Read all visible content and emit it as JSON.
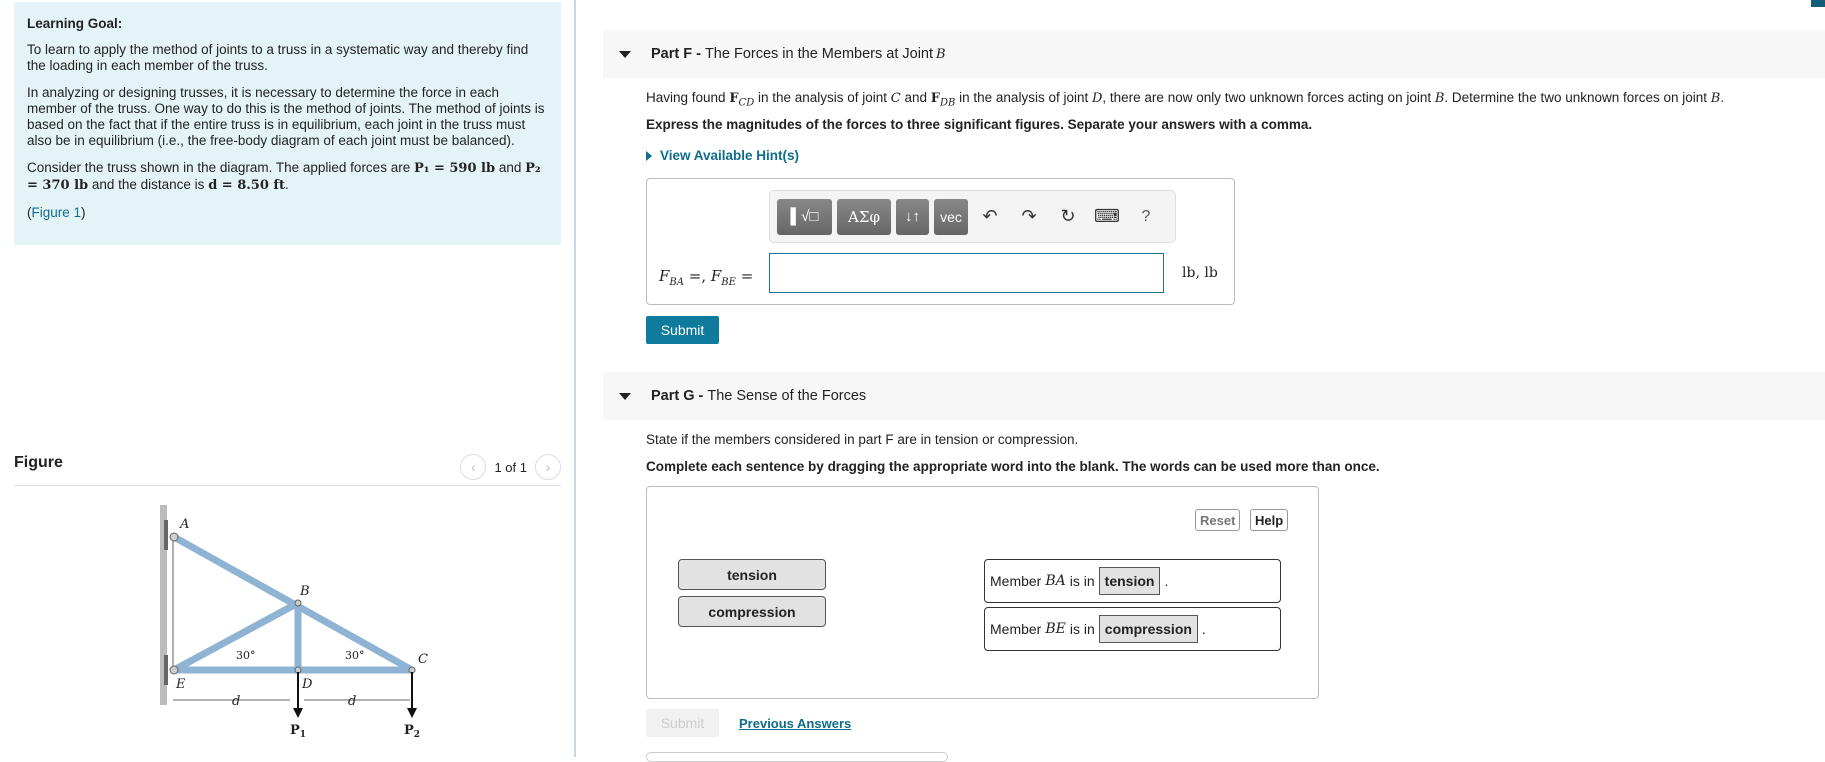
{
  "learning_goal": {
    "title": "Learning Goal:",
    "p1": "To learn to apply the method of joints to a truss in a systematic way and thereby find the loading in each member of the truss.",
    "p2": "In analyzing or designing trusses, it is necessary to determine the force in each member of the truss. One way to do this is the method of joints. The method of joints is based on the fact that if the entire truss is in equilibrium, each joint in the truss must also be in equilibrium (i.e., the free-body diagram of each joint must be balanced).",
    "p3_a": "Consider the truss shown in the diagram. The applied forces are ",
    "p1_eq": "P₁ = 590 lb",
    "p3_b": " and ",
    "p2_eq": "P₂ = 370 lb",
    "p3_c": " and the distance is ",
    "d_eq": "d = 8.50 ft",
    "p3_d": ".",
    "figure_link_open": "(",
    "figure_link": "Figure 1",
    "figure_link_close": ")"
  },
  "figure": {
    "title": "Figure",
    "pager": "1 of 1",
    "prev_icon": "chevron-left",
    "next_icon": "chevron-right",
    "labels": {
      "A": "A",
      "B": "B",
      "C": "C",
      "D": "D",
      "E": "E",
      "d1": "d",
      "d2": "d",
      "angle1": "30°",
      "angle2": "30°",
      "P1": "P",
      "P1_sub": "1",
      "P2": "P",
      "P2_sub": "2"
    }
  },
  "part_f": {
    "label": "Part F -",
    "title": "The Forces in the Members at Joint ",
    "title_var": "B",
    "desc_a": "Having found ",
    "fcd": "F",
    "fcd_sub": "CD",
    "desc_b": " in the analysis of joint ",
    "c": "C",
    "desc_c": " and ",
    "fdb": "F",
    "fdb_sub": "DB",
    "desc_d": " in the analysis of joint ",
    "d": "D",
    "desc_e": ", there are now only two unknown forces acting on joint ",
    "b1": "B",
    "desc_f": ". Determine the two unknown forces on joint ",
    "b2": "B",
    "desc_g": ".",
    "instruction": "Express the magnitudes of the forces to three significant figures. Separate your answers with a comma.",
    "hint": "View Available Hint(s)",
    "toolbar": {
      "templates": "▌√□",
      "greek": "ΑΣφ",
      "updown": "↓↑",
      "vec": "vec",
      "undo": "↶",
      "redo": "↷",
      "reset": "↻",
      "keyboard": "⌨",
      "help": "?"
    },
    "eq_f1": "F",
    "eq_f1_sub": "BA",
    "eq_mid": " =, ",
    "eq_f2": "F",
    "eq_f2_sub": "BE",
    "eq_end": " =",
    "input_value": "",
    "units": "lb, lb",
    "submit": "Submit"
  },
  "part_g": {
    "label": "Part G -",
    "title": "The Sense of the Forces",
    "desc": "State if the members considered in part F are in tension or compression.",
    "instruction": "Complete each sentence by dragging the appropriate word into the blank. The words can be used more than once.",
    "reset": "Reset",
    "help": "Help",
    "tokens": [
      "tension",
      "compression"
    ],
    "sentences": [
      {
        "pre": "Member ",
        "member": "BA",
        "mid": " is in",
        "answer": "tension",
        "post": "."
      },
      {
        "pre": "Member ",
        "member": "BE",
        "mid": " is in",
        "answer": "compression",
        "post": "."
      }
    ],
    "submit": "Submit",
    "previous_answers": "Previous Answers"
  }
}
